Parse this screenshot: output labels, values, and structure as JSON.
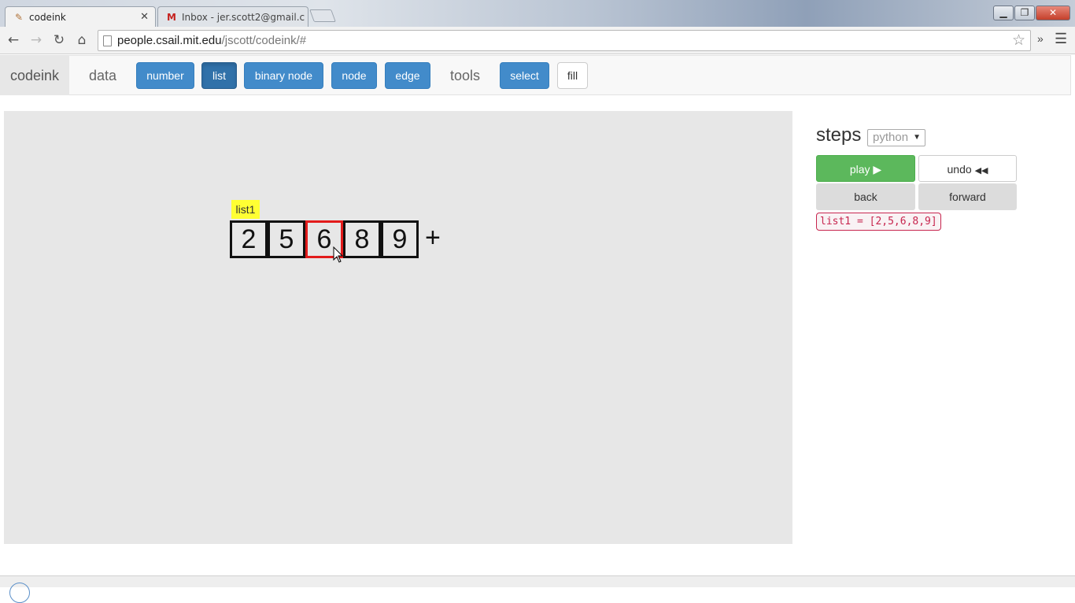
{
  "browser": {
    "tabs": [
      {
        "title": "codeink",
        "icon": "codeink-favicon",
        "active": true
      },
      {
        "title": "Inbox - jer.scott2@gmail.c",
        "icon": "gmail-icon",
        "active": false
      }
    ],
    "url_domain": "people.csail.mit.edu",
    "url_path": "/jscott/codeink/#"
  },
  "navbar": {
    "brand": "codeink",
    "data_label": "data",
    "data_buttons": [
      "number",
      "list",
      "binary node",
      "node",
      "edge"
    ],
    "active_button": "list",
    "tools_label": "tools",
    "tool_buttons": [
      "select",
      "fill"
    ]
  },
  "canvas": {
    "list_label": "list1",
    "cells": [
      "2",
      "5",
      "6",
      "8",
      "9"
    ],
    "selected_index": 2,
    "add_symbol": "+"
  },
  "steps": {
    "title": "steps",
    "language": "python",
    "play_label": "play",
    "undo_label": "undo",
    "back_label": "back",
    "forward_label": "forward",
    "code": "list1 = [2,5,6,8,9]"
  },
  "colors": {
    "primary": "#428bca",
    "success": "#5cb85c",
    "canvas_bg": "#e7e7e7",
    "label_highlight": "#ffff33",
    "selection": "#e21b1b",
    "code_text": "#c7254e"
  }
}
